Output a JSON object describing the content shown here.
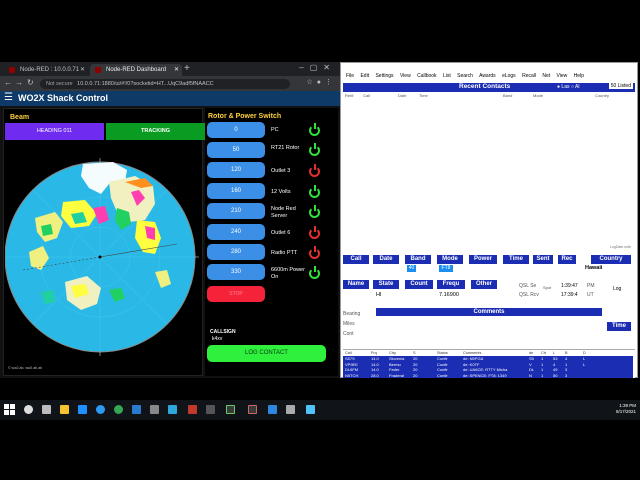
{
  "browser": {
    "tabs": [
      {
        "title": "Node-RED : 10.0.0.71",
        "active": false
      },
      {
        "title": "Node-RED Dashboard",
        "active": true
      }
    ],
    "url_warning": "Not secure",
    "url": "10.0.0.71:1880/ui/#!/0?socketid=HT...UqC9adf5fNAACC"
  },
  "dashboard": {
    "title": "WO2X Shack Control",
    "beam": {
      "title": "Beam",
      "heading_label": "HEADING 011",
      "tracking_label": "TRACKING",
      "map_legend": "© ww2.ab. ww2.ab.ab"
    },
    "rotor": {
      "title": "Rotor & Power Switch",
      "angles": [
        "0",
        "50",
        "120",
        "160",
        "210",
        "240",
        "280",
        "330"
      ],
      "outlets": [
        {
          "label": "PC",
          "state": "on"
        },
        {
          "label": "RT21 Rotor",
          "state": "on"
        },
        {
          "label": "Outlet 3",
          "state": "off"
        },
        {
          "label": "12 Volts",
          "state": "on"
        },
        {
          "label": "Node Red Server",
          "state": "on"
        },
        {
          "label": "Outlet 6",
          "state": "off"
        },
        {
          "label": "Radio PTT",
          "state": "off"
        },
        {
          "label": "6600m Power On",
          "state": "on"
        }
      ],
      "stop_label": "STOP",
      "callsign_label": "CALLSIGN",
      "callsign_value": "k4xv",
      "log_button": "LOG CONTACT"
    }
  },
  "logger": {
    "menu": [
      "File",
      "Edit",
      "Settings",
      "View",
      "Callbook",
      "List",
      "Search",
      "Awards",
      "eLogs",
      "Recall",
      "Net",
      "View",
      "Help"
    ],
    "recent_title": "Recent Contacts",
    "radio_last": "Las",
    "radio_all": "Al",
    "listed": "50 Listed",
    "columns": [
      "Ref#",
      "Call",
      "Date",
      "Time",
      "Band",
      "Mode",
      "Country"
    ],
    "count_text": "LogDate.mdb",
    "fields1": [
      "Call",
      "Date",
      "Band",
      "Mode",
      "Power",
      "Time",
      "Sent",
      "Rec",
      "Country"
    ],
    "band_value": "40",
    "mode_value": "FT8",
    "country_value": "Hawaii",
    "fields2": [
      "Name",
      "State",
      "Count",
      "Frequ",
      "Other"
    ],
    "state_value": "HI",
    "freq_value": "7.16900",
    "qsl": {
      "qsl_se": "QSL Se",
      "qsl_rcv": "QSL Rcv",
      "spot": "Spot",
      "time1": "1:39:47",
      "pm": "PM",
      "time2": "17:39:4",
      "utc": "UT",
      "log": "Log"
    },
    "bearing": "Bearing",
    "miles": "Miles",
    "cont": "Cont",
    "comments": "Comments",
    "time_button": "Time",
    "spot_columns": [
      "Call",
      "Frq",
      "Ctry",
      "S",
      "Status",
      "Comments",
      "de",
      "Ctr",
      "L",
      "B",
      "D"
    ],
    "spots": [
      [
        "S57S",
        "14.0",
        "Slovenia",
        "20",
        "Confir",
        "de: N5PGA",
        "S5",
        "1",
        "53",
        "4",
        "L"
      ],
      [
        "VP9EE",
        "14.0",
        "Bermu",
        "20",
        "Confir",
        "de: K0TF",
        "V",
        "1",
        "4",
        "1",
        "L"
      ],
      [
        "DL6FM",
        "14.0",
        "Feder",
        "20",
        "Confir",
        "de: UA6CE: RTTY Micha",
        "DL",
        "1",
        "49",
        "3",
        ""
      ],
      [
        "N5TCH",
        "28.0",
        "Fraderal",
        "20",
        "Confir",
        "de: SPENCE: FT8: 1349",
        "N",
        "1",
        "50",
        "3",
        ""
      ]
    ]
  },
  "taskbar": {
    "time": "1:39 PM",
    "date": "8/17/2021"
  }
}
